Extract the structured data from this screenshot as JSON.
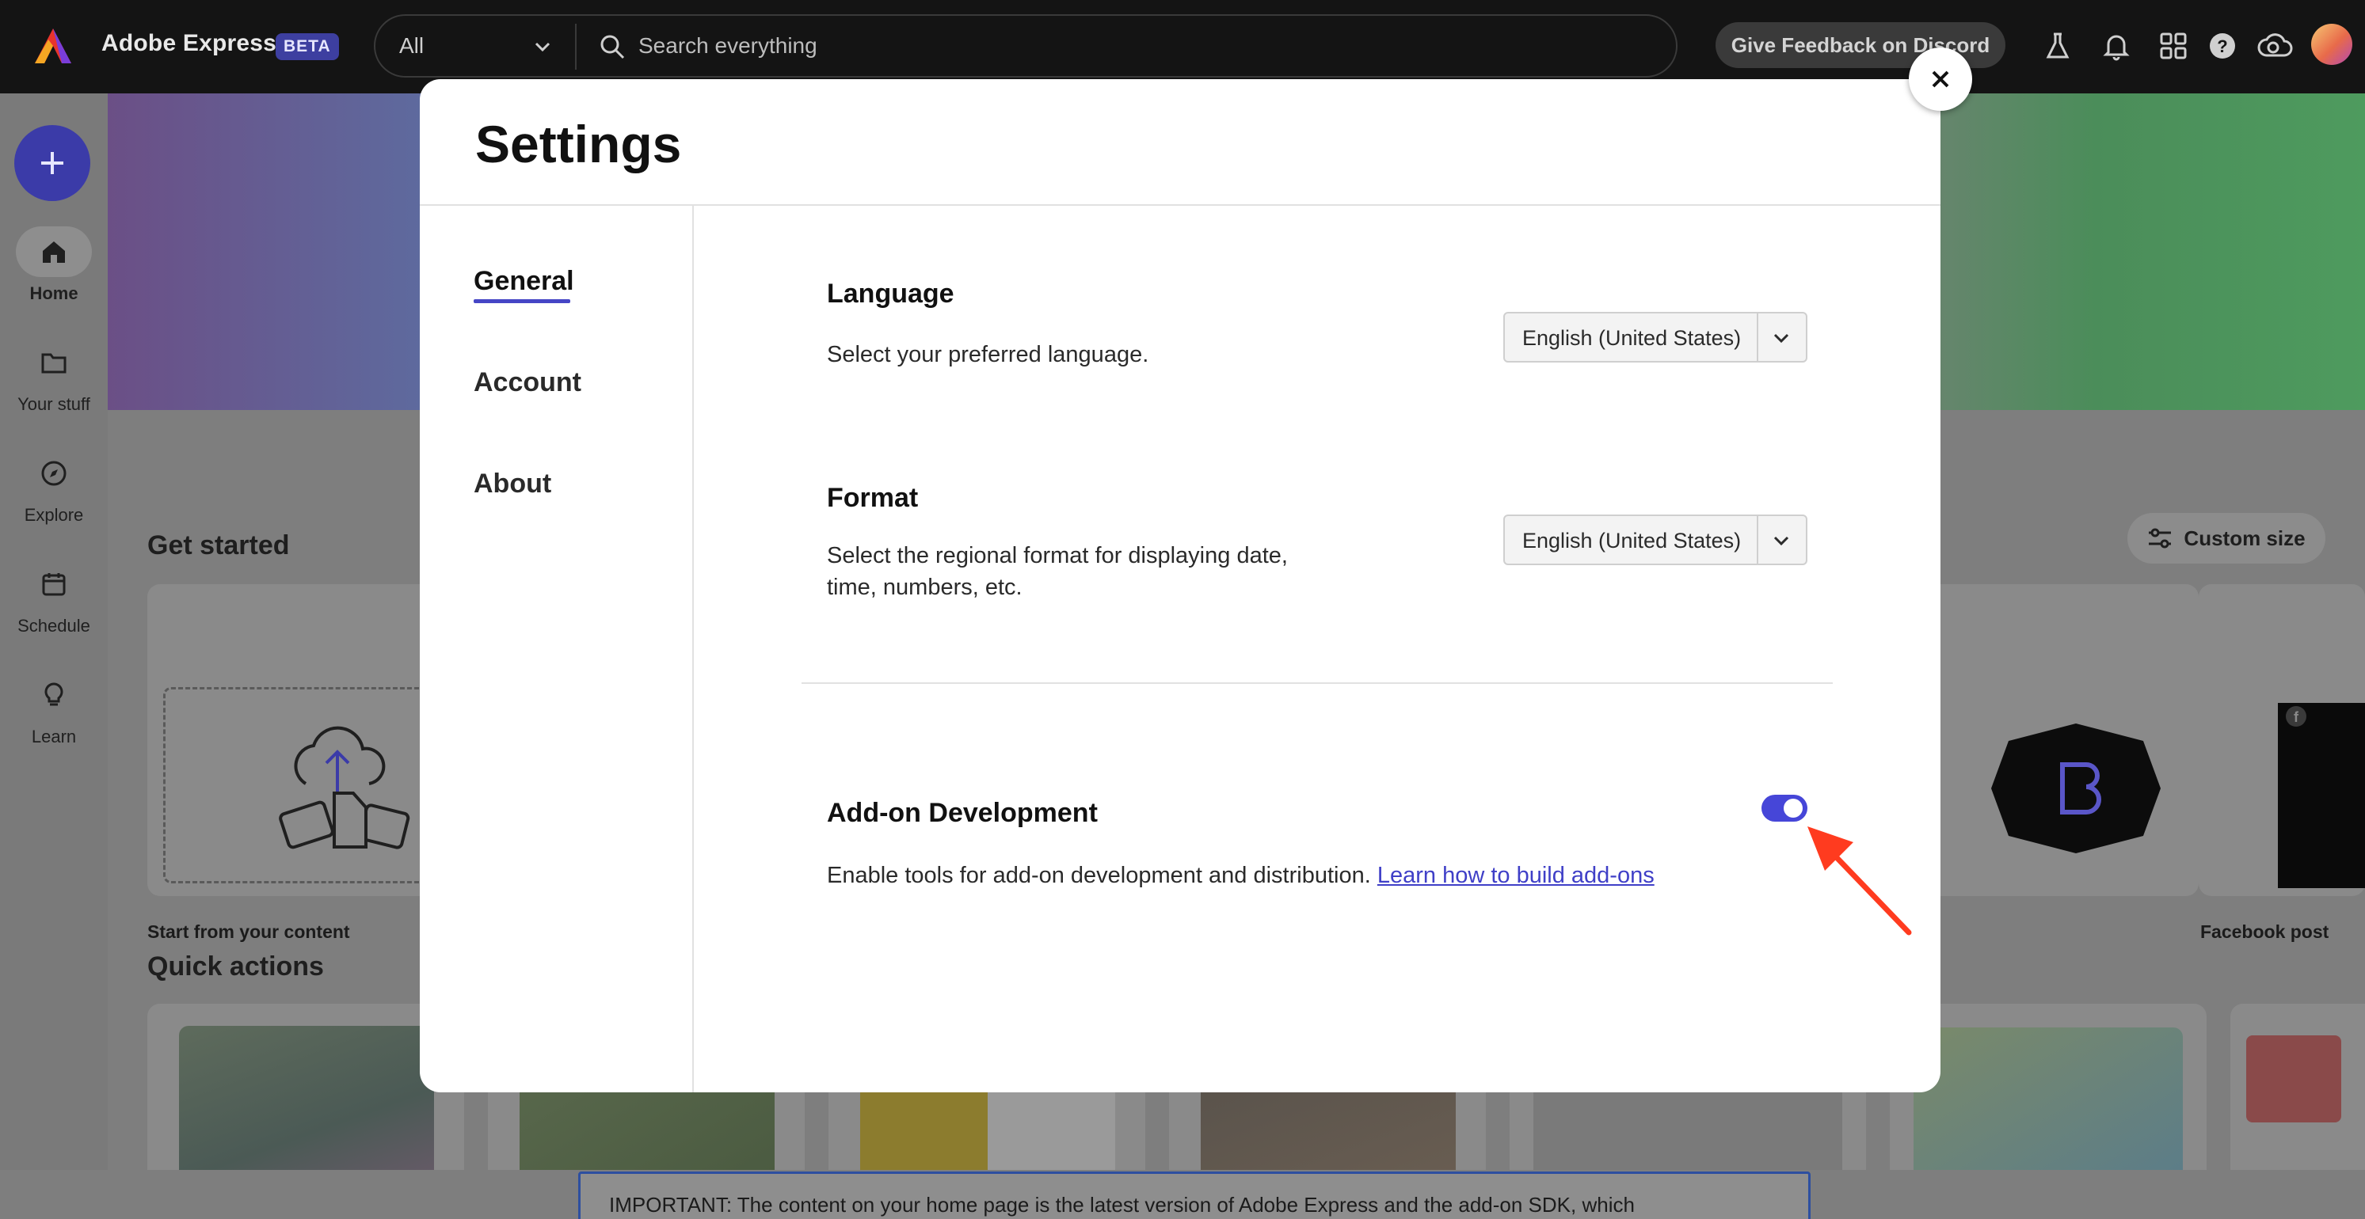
{
  "app": {
    "brand": "Adobe Express",
    "badge": "BETA"
  },
  "topbar": {
    "scope": "All",
    "search_placeholder": "Search everything",
    "feedback_label": "Give Feedback on Discord",
    "icons": [
      "flask-icon",
      "bell-icon",
      "apps-grid-icon",
      "help-icon",
      "creative-cloud-icon"
    ]
  },
  "rail": {
    "create_label": "+",
    "items": [
      {
        "label": "Home",
        "icon": "home-icon"
      },
      {
        "label": "Your stuff",
        "icon": "folder-icon"
      },
      {
        "label": "Explore",
        "icon": "compass-icon"
      },
      {
        "label": "Schedule",
        "icon": "calendar-icon"
      },
      {
        "label": "Learn",
        "icon": "lightbulb-icon"
      }
    ]
  },
  "background": {
    "get_started_title": "Get started",
    "start_card_label": "Start from your content",
    "facebook_card_label": "Facebook post",
    "custom_size_label": "Custom size",
    "quick_actions_title": "Quick actions",
    "banner_text": "IMPORTANT: The content on your home page is the latest version of Adobe Express and the add-on SDK, which"
  },
  "settings": {
    "title": "Settings",
    "nav": [
      "General",
      "Account",
      "About"
    ],
    "language": {
      "heading": "Language",
      "description": "Select your preferred language.",
      "value": "English (United States)"
    },
    "format": {
      "heading": "Format",
      "description_line1": "Select the regional format for displaying date,",
      "description_line2": "time, numbers, etc.",
      "value": "English (United States)"
    },
    "addon": {
      "heading": "Add-on Development",
      "description": "Enable tools for add-on development and distribution.",
      "link": "Learn how to build add-ons",
      "enabled": true
    },
    "accent": "#4646d8",
    "annotation_color": "#ff3b1f"
  }
}
